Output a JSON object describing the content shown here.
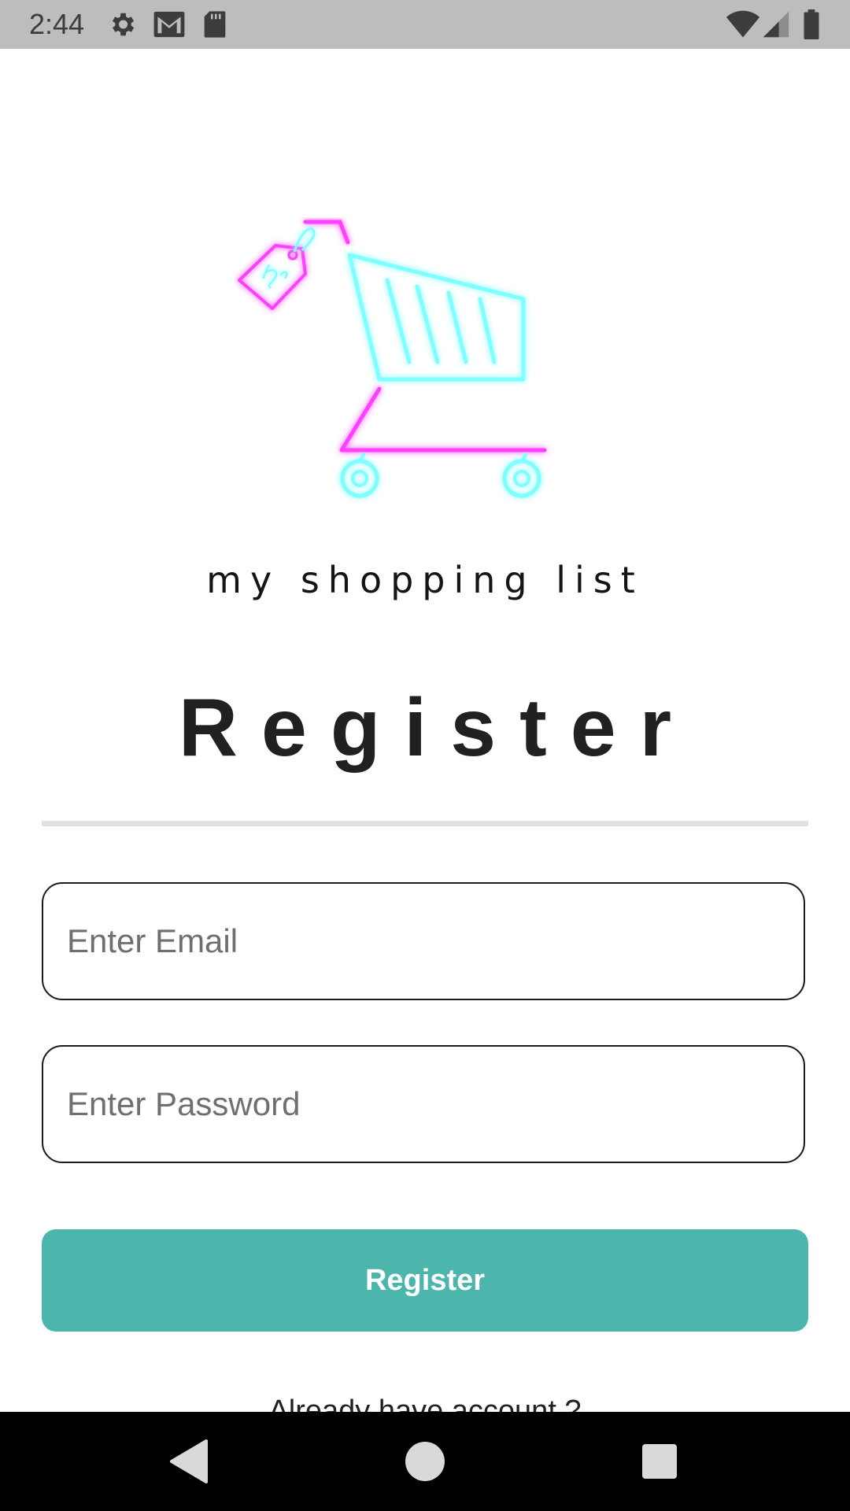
{
  "status_bar": {
    "time": "2:44",
    "icons_left": [
      "gear-icon",
      "gmail-icon",
      "sd-card-icon"
    ],
    "icons_right": [
      "wifi-icon",
      "cell-signal-icon",
      "battery-icon"
    ]
  },
  "logo": {
    "brand_text": "my shopping list",
    "icon": "neon-shopping-cart-icon"
  },
  "page": {
    "title": "Register"
  },
  "form": {
    "email_placeholder": "Enter Email",
    "email_value": "",
    "password_placeholder": "Enter Password",
    "password_value": "",
    "submit_label": "Register"
  },
  "footer": {
    "login_prompt": "Already have account ?"
  },
  "nav_bar": {
    "buttons": [
      "back-icon",
      "home-icon",
      "recents-icon"
    ]
  },
  "colors": {
    "accent": "#4db6ac",
    "neon_pink": "#ff40ff",
    "neon_cyan": "#7fffff"
  }
}
